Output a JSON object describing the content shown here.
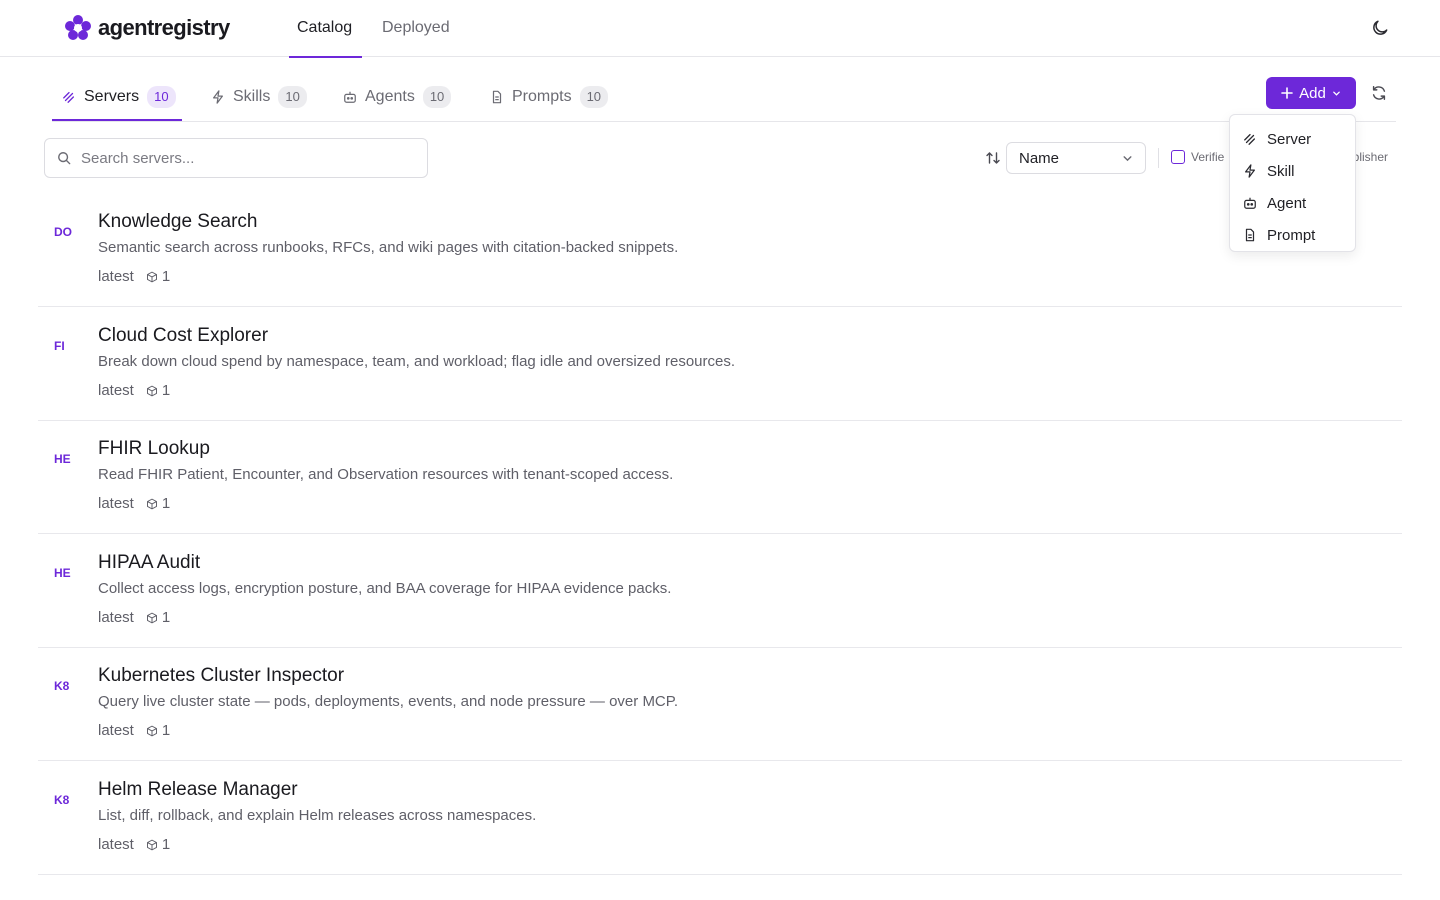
{
  "app": {
    "name": "agentregistry"
  },
  "nav": {
    "catalog": "Catalog",
    "deployed": "Deployed"
  },
  "tabs": [
    {
      "label": "Servers",
      "count": "10"
    },
    {
      "label": "Skills",
      "count": "10"
    },
    {
      "label": "Agents",
      "count": "10"
    },
    {
      "label": "Prompts",
      "count": "10"
    }
  ],
  "toolbar": {
    "add_label": "Add"
  },
  "search": {
    "placeholder": "Search servers...",
    "value": ""
  },
  "sort": {
    "selected": "Name"
  },
  "filters": {
    "verified_label": "Verifie",
    "publisher_label": "ublisher"
  },
  "add_menu": {
    "items": [
      "Server",
      "Skill",
      "Agent",
      "Prompt"
    ]
  },
  "servers": [
    {
      "abbr": "DO",
      "name": "Knowledge Search",
      "description": "Semantic search across runbooks, RFCs, and wiki pages with citation-backed snippets.",
      "tag": "latest",
      "versions": "1"
    },
    {
      "abbr": "FI",
      "name": "Cloud Cost Explorer",
      "description": "Break down cloud spend by namespace, team, and workload; flag idle and oversized resources.",
      "tag": "latest",
      "versions": "1"
    },
    {
      "abbr": "HE",
      "name": "FHIR Lookup",
      "description": "Read FHIR Patient, Encounter, and Observation resources with tenant-scoped access.",
      "tag": "latest",
      "versions": "1"
    },
    {
      "abbr": "HE",
      "name": "HIPAA Audit",
      "description": "Collect access logs, encryption posture, and BAA coverage for HIPAA evidence packs.",
      "tag": "latest",
      "versions": "1"
    },
    {
      "abbr": "K8",
      "name": "Kubernetes Cluster Inspector",
      "description": "Query live cluster state — pods, deployments, events, and node pressure — over MCP.",
      "tag": "latest",
      "versions": "1"
    },
    {
      "abbr": "K8",
      "name": "Helm Release Manager",
      "description": "List, diff, rollback, and explain Helm releases across namespaces.",
      "tag": "latest",
      "versions": "1"
    }
  ],
  "colors": {
    "accent": "#6d28d9",
    "accent_soft": "#ede5fb"
  }
}
